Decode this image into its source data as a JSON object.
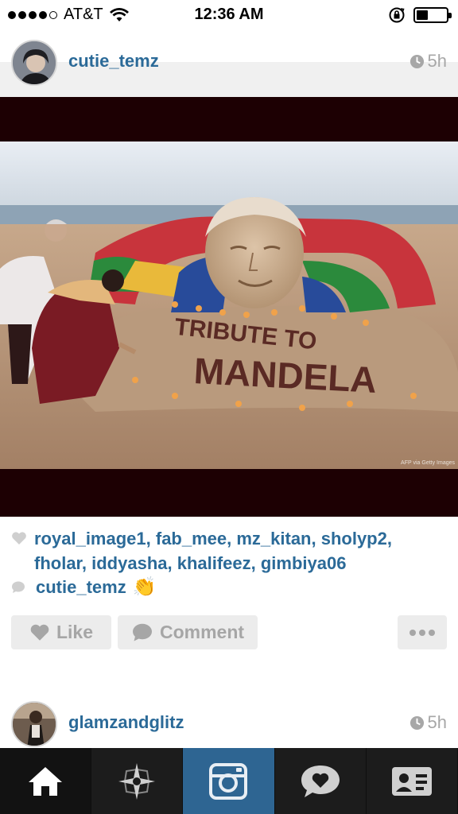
{
  "status_bar": {
    "carrier": "AT&T",
    "time": "12:36 AM",
    "signal_bars_filled": 4,
    "signal_bars_total": 5,
    "battery_level_percent": 30
  },
  "post": {
    "username": "cutie_temz",
    "time_ago": "5h",
    "photo": {
      "sculpture_text_line1": "TRIBUTE TO",
      "sculpture_text_line2": "MANDELA",
      "credit": "AFP via Getty Images"
    },
    "likes_text": "royal_image1, fab_mee, mz_kitan, sholyp2, fholar, iddyasha, khalifeez, gimbiya06",
    "comment_user": "cutie_temz",
    "comment_emoji": "👏"
  },
  "actions": {
    "like_label": "Like",
    "comment_label": "Comment"
  },
  "next_post": {
    "username": "glamzandglitz",
    "time_ago": "5h"
  },
  "tab_bar": {
    "tabs": [
      "home",
      "explore",
      "camera",
      "activity",
      "profile"
    ],
    "active_tab": "home"
  },
  "colors": {
    "link": "#2b6a98",
    "muted": "#a7a7a7",
    "tab_bar": "#1c1c1c",
    "camera_tab": "#2e6592"
  }
}
